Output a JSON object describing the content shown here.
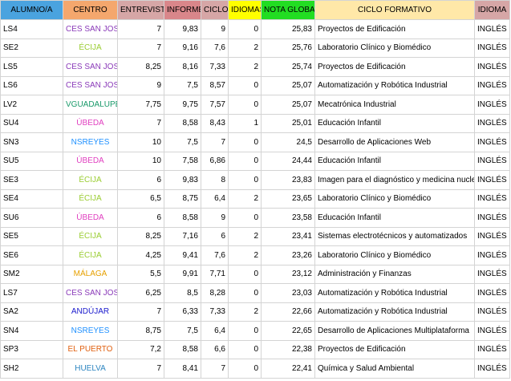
{
  "sheet": {
    "columns": [
      {
        "key": "alumno",
        "label": "ALUMNO/A",
        "bg": "#4aa3df",
        "align": "left"
      },
      {
        "key": "centro",
        "label": "CENTRO",
        "bg": "#f4a76d",
        "align": "center"
      },
      {
        "key": "entrevista",
        "label": "ENTREVISTA",
        "bg": "#d6a6a6",
        "align": "num"
      },
      {
        "key": "informe",
        "label": "INFORME",
        "bg": "#d9868a",
        "align": "num"
      },
      {
        "key": "ciclo",
        "label": "CICLO",
        "bg": "#d6a6a6",
        "align": "num"
      },
      {
        "key": "idiomas",
        "label": "IDIOMAS",
        "bg": "#ffff00",
        "align": "num"
      },
      {
        "key": "nota_global",
        "label": "NOTA GLOBAL",
        "bg": "#22dd22",
        "align": "num"
      },
      {
        "key": "ciclo_formativo",
        "label": "CICLO FORMATIVO",
        "bg": "#ffe8a8",
        "align": "left"
      },
      {
        "key": "idioma",
        "label": "IDIOMA",
        "bg": "#d6a6a6",
        "align": "left"
      }
    ],
    "centro_colors": {
      "CES SAN JOSÉ": "#8a3ab9",
      "ÉCIJA": "#9acd32",
      "VGUADALUPE": "#1a9a6a",
      "ÚBEDA": "#e040c0",
      "NSREYES": "#1e90ff",
      "MÁLAGA": "#e6a000",
      "ANDÚJAR": "#1a1acd",
      "EL PUERTO": "#e06010",
      "HUELVA": "#2e86c1"
    },
    "rows": [
      {
        "alumno": "LS4",
        "centro": "CES SAN JOSÉ",
        "entrevista": "7",
        "informe": "9,83",
        "ciclo": "9",
        "idiomas": "0",
        "nota_global": "25,83",
        "ciclo_formativo": "Proyectos de Edificación",
        "idioma": "INGLÉS"
      },
      {
        "alumno": "SE2",
        "centro": "ÉCIJA",
        "entrevista": "7",
        "informe": "9,16",
        "ciclo": "7,6",
        "idiomas": "2",
        "nota_global": "25,76",
        "ciclo_formativo": "Laboratorio Clínico y Biomédico",
        "idioma": "INGLÉS"
      },
      {
        "alumno": "LS5",
        "centro": "CES SAN JOSÉ",
        "entrevista": "8,25",
        "informe": "8,16",
        "ciclo": "7,33",
        "idiomas": "2",
        "nota_global": "25,74",
        "ciclo_formativo": "Proyectos de Edificación",
        "idioma": "INGLÉS"
      },
      {
        "alumno": "LS6",
        "centro": "CES SAN JOSÉ",
        "entrevista": "9",
        "informe": "7,5",
        "ciclo": "8,57",
        "idiomas": "0",
        "nota_global": "25,07",
        "ciclo_formativo": "Automatización y Robótica Industrial",
        "idioma": "INGLÉS"
      },
      {
        "alumno": "LV2",
        "centro": "VGUADALUPE",
        "entrevista": "7,75",
        "informe": "9,75",
        "ciclo": "7,57",
        "idiomas": "0",
        "nota_global": "25,07",
        "ciclo_formativo": "Mecatrónica Industrial",
        "idioma": "INGLÉS"
      },
      {
        "alumno": "SU4",
        "centro": "ÚBEDA",
        "entrevista": "7",
        "informe": "8,58",
        "ciclo": "8,43",
        "idiomas": "1",
        "nota_global": "25,01",
        "ciclo_formativo": "Educación Infantil",
        "idioma": "INGLÉS"
      },
      {
        "alumno": "SN3",
        "centro": "NSREYES",
        "entrevista": "10",
        "informe": "7,5",
        "ciclo": "7",
        "idiomas": "0",
        "nota_global": "24,5",
        "ciclo_formativo": "Desarrollo de Aplicaciones Web",
        "idioma": "INGLÉS"
      },
      {
        "alumno": "SU5",
        "centro": "ÚBEDA",
        "entrevista": "10",
        "informe": "7,58",
        "ciclo": "6,86",
        "idiomas": "0",
        "nota_global": "24,44",
        "ciclo_formativo": "Educación Infantil",
        "idioma": "INGLÉS"
      },
      {
        "alumno": "SE3",
        "centro": "ÉCIJA",
        "entrevista": "6",
        "informe": "9,83",
        "ciclo": "8",
        "idiomas": "0",
        "nota_global": "23,83",
        "ciclo_formativo": "Imagen para el diagnóstico y medicina nuclear",
        "idioma": "INGLÉS"
      },
      {
        "alumno": "SE4",
        "centro": "ÉCIJA",
        "entrevista": "6,5",
        "informe": "8,75",
        "ciclo": "6,4",
        "idiomas": "2",
        "nota_global": "23,65",
        "ciclo_formativo": "Laboratorio Clínico y Biomédico",
        "idioma": "INGLÉS"
      },
      {
        "alumno": "SU6",
        "centro": "ÚBEDA",
        "entrevista": "6",
        "informe": "8,58",
        "ciclo": "9",
        "idiomas": "0",
        "nota_global": "23,58",
        "ciclo_formativo": "Educación Infantil",
        "idioma": "INGLÉS"
      },
      {
        "alumno": "SE5",
        "centro": "ÉCIJA",
        "entrevista": "8,25",
        "informe": "7,16",
        "ciclo": "6",
        "idiomas": "2",
        "nota_global": "23,41",
        "ciclo_formativo": "Sistemas electrotécnicos y automatizados",
        "idioma": "INGLÉS"
      },
      {
        "alumno": "SE6",
        "centro": "ÉCIJA",
        "entrevista": "4,25",
        "informe": "9,41",
        "ciclo": "7,6",
        "idiomas": "2",
        "nota_global": "23,26",
        "ciclo_formativo": "Laboratorio Clínico y Biomédico",
        "idioma": "INGLÉS"
      },
      {
        "alumno": "SM2",
        "centro": "MÁLAGA",
        "entrevista": "5,5",
        "informe": "9,91",
        "ciclo": "7,71",
        "idiomas": "0",
        "nota_global": "23,12",
        "ciclo_formativo": "Administración y Finanzas",
        "idioma": "INGLÉS"
      },
      {
        "alumno": "LS7",
        "centro": "CES SAN JOSÉ",
        "entrevista": "6,25",
        "informe": "8,5",
        "ciclo": "8,28",
        "idiomas": "0",
        "nota_global": "23,03",
        "ciclo_formativo": "Automatización y Robótica Industrial",
        "idioma": "INGLÉS"
      },
      {
        "alumno": "SA2",
        "centro": "ANDÚJAR",
        "entrevista": "7",
        "informe": "6,33",
        "ciclo": "7,33",
        "idiomas": "2",
        "nota_global": "22,66",
        "ciclo_formativo": "Automatización y Robótica Industrial",
        "idioma": "INGLÉS"
      },
      {
        "alumno": "SN4",
        "centro": "NSREYES",
        "entrevista": "8,75",
        "informe": "7,5",
        "ciclo": "6,4",
        "idiomas": "0",
        "nota_global": "22,65",
        "ciclo_formativo": "Desarrollo de Aplicaciones Multiplataforma",
        "idioma": "INGLÉS"
      },
      {
        "alumno": "SP3",
        "centro": "EL PUERTO",
        "entrevista": "7,2",
        "informe": "8,58",
        "ciclo": "6,6",
        "idiomas": "0",
        "nota_global": "22,38",
        "ciclo_formativo": "Proyectos de Edificación",
        "idioma": "INGLÉS"
      },
      {
        "alumno": "SH2",
        "centro": "HUELVA",
        "entrevista": "7",
        "informe": "8,41",
        "ciclo": "7",
        "idiomas": "0",
        "nota_global": "22,41",
        "ciclo_formativo": "Química y Salud Ambiental",
        "idioma": "INGLÉS"
      }
    ]
  }
}
